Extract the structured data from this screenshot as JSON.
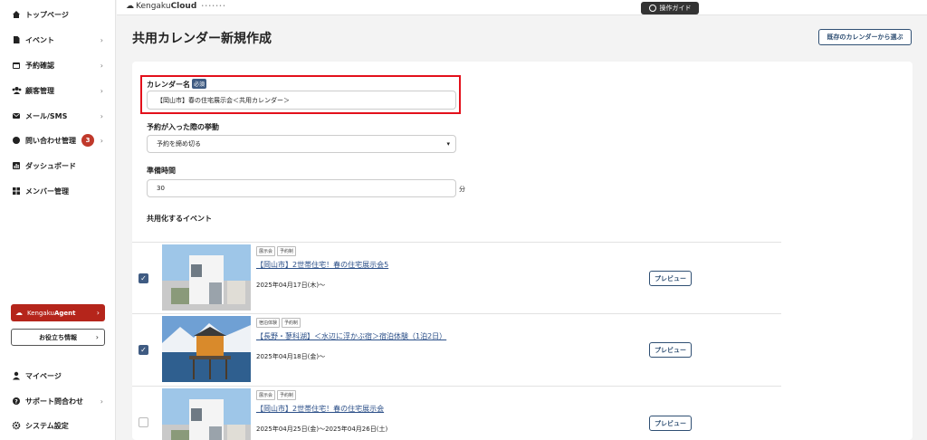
{
  "sidebar": {
    "items": [
      {
        "label": "トップページ",
        "icon": "home-icon"
      },
      {
        "label": "イベント",
        "icon": "document-icon"
      },
      {
        "label": "予約確認",
        "icon": "calendar-icon"
      },
      {
        "label": "顧客管理",
        "icon": "users-icon"
      },
      {
        "label": "メール/SMS",
        "icon": "mail-icon"
      },
      {
        "label": "問い合わせ管理",
        "icon": "chat-icon",
        "badge": "3"
      },
      {
        "label": "ダッシュボード",
        "icon": "chart-icon"
      },
      {
        "label": "メンバー管理",
        "icon": "grid-icon"
      }
    ],
    "agent_brand": "Kengaku",
    "agent_brand_bold": "Agent",
    "info_label": "お役立ち情報",
    "bottom_items": [
      {
        "label": "マイページ",
        "icon": "user-icon"
      },
      {
        "label": "サポート問合わせ",
        "icon": "help-icon"
      },
      {
        "label": "システム設定",
        "icon": "gear-icon"
      }
    ]
  },
  "header": {
    "logo_prefix": "Kengaku",
    "logo_bold": "Cloud",
    "logo_sub": "•••••••",
    "guide_label": "操作ガイド"
  },
  "page": {
    "title": "共用カレンダー新規作成",
    "choose_existing_label": "既存のカレンダーから選ぶ"
  },
  "form": {
    "name_label": "カレンダー名",
    "required_badge": "必須",
    "name_value": "【岡山市】春の住宅展示会＜共用カレンダー＞",
    "behavior_label": "予約が入った際の挙動",
    "behavior_value": "予約を締め切る",
    "prep_label": "準備時間",
    "prep_value": "30",
    "prep_unit": "分",
    "shared_events_label": "共用化するイベント"
  },
  "events": [
    {
      "checked": true,
      "tags": [
        "展示会",
        "予約制"
      ],
      "title": "【岡山市】2世帯住宅！春の住宅展示会5",
      "date": "2025年04月17日(木)〜",
      "preview_label": "プレビュー"
    },
    {
      "checked": true,
      "tags": [
        "宿泊体験",
        "予約制"
      ],
      "title": "【長野・蓼科湖】＜水辺に浮かぶ宿＞宿泊体験（1泊2日）",
      "date": "2025年04月18日(金)〜",
      "preview_label": "プレビュー"
    },
    {
      "checked": false,
      "tags": [
        "展示会",
        "予約制"
      ],
      "title": "【岡山市】2世帯住宅！春の住宅展示会",
      "date": "2025年04月25日(金)〜2025年04月26日(土)",
      "preview_label": "プレビュー"
    }
  ],
  "colors": {
    "accent": "#3f5b82",
    "agent_red": "#b5251b",
    "highlight_red": "#e3101b",
    "link": "#2b4f88"
  }
}
